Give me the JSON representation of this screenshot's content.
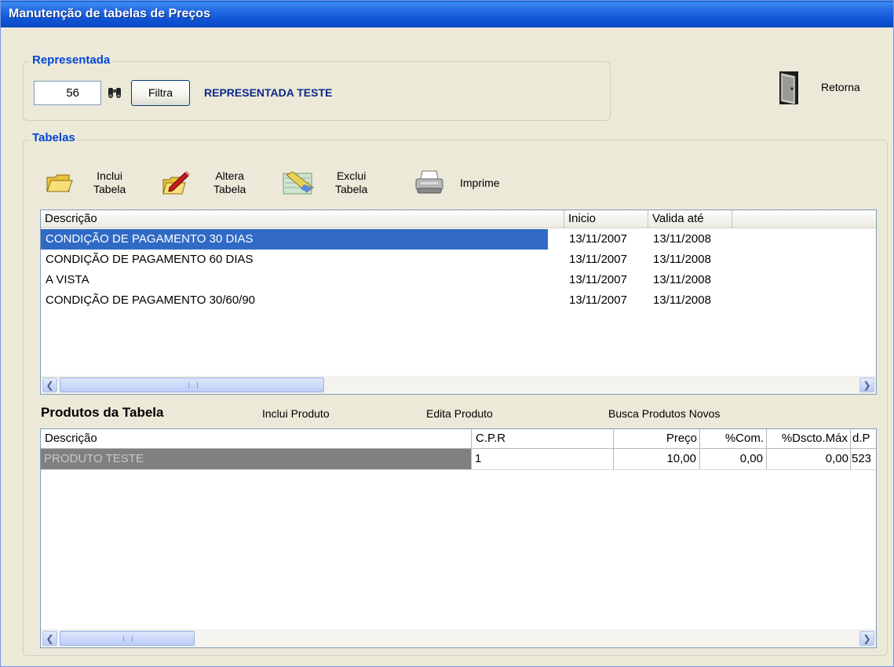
{
  "window": {
    "title": "Manutenção de tabelas de Preços"
  },
  "representada": {
    "legend": "Representada",
    "code_value": "56",
    "search_icon": "binoculars-icon",
    "filter_label": "Filtra",
    "name": "REPRESENTADA TESTE"
  },
  "retorna": {
    "label": "Retorna",
    "icon": "door-exit-icon"
  },
  "tabelas": {
    "legend": "Tabelas",
    "toolbar": {
      "inclui": {
        "line1": "Inclui",
        "line2": "Tabela",
        "icon": "folder-open-icon"
      },
      "altera": {
        "line1": "Altera",
        "line2": "Tabela",
        "icon": "edit-pencil-icon"
      },
      "exclui": {
        "line1": "Exclui",
        "line2": "Tabela",
        "icon": "eraser-icon"
      },
      "imprime": {
        "label": "Imprime",
        "icon": "printer-icon"
      }
    },
    "columns": [
      "Descrição",
      "Inicio",
      "Valida até"
    ],
    "rows": [
      {
        "descricao": "CONDIÇÃO DE PAGAMENTO 30 DIAS",
        "inicio": "13/11/2007",
        "valida": "13/11/2008"
      },
      {
        "descricao": "CONDIÇÃO DE PAGAMENTO 60 DIAS",
        "inicio": "13/11/2007",
        "valida": "13/11/2008"
      },
      {
        "descricao": "A VISTA",
        "inicio": "13/11/2007",
        "valida": "13/11/2008"
      },
      {
        "descricao": "CONDIÇÃO DE PAGAMENTO 30/60/90",
        "inicio": "13/11/2007",
        "valida": "13/11/2008"
      }
    ]
  },
  "produtos": {
    "title": "Produtos da Tabela",
    "inclui_label": "Inclui Produto",
    "edita_label": "Edita Produto",
    "busca_label": "Busca Produtos Novos",
    "columns": [
      "Descrição",
      "C.P.R",
      "Preço",
      "%Com.",
      "%Dscto.Máx",
      "d.P"
    ],
    "rows": [
      {
        "descricao": "PRODUTO TESTE",
        "cpr": "1",
        "preco": "10,00",
        "com": "0,00",
        "dscto": "0,00",
        "dp": "523"
      }
    ]
  },
  "colors": {
    "title_bar": "#0a5fd8",
    "selection": "#316ac5",
    "legend": "#0046d5",
    "grid_selection": "#808080"
  }
}
